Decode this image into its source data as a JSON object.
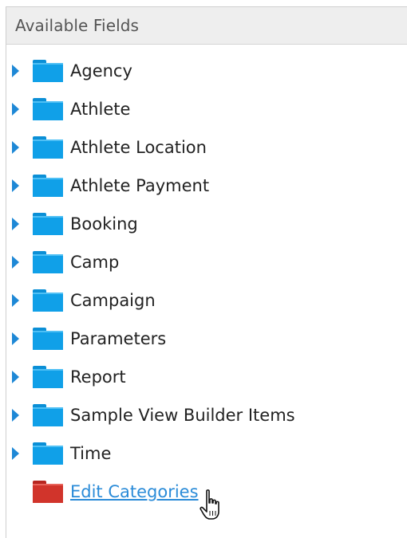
{
  "panel": {
    "title": "Available Fields"
  },
  "tree": {
    "items": [
      {
        "label": "Agency"
      },
      {
        "label": "Athlete"
      },
      {
        "label": "Athlete Location"
      },
      {
        "label": "Athlete Payment"
      },
      {
        "label": "Booking"
      },
      {
        "label": "Camp"
      },
      {
        "label": "Campaign"
      },
      {
        "label": "Parameters"
      },
      {
        "label": "Report"
      },
      {
        "label": "Sample View Builder Items"
      },
      {
        "label": "Time"
      }
    ],
    "edit_link": {
      "label": "Edit Categories"
    }
  },
  "colors": {
    "folder_blue": "#10a0e8",
    "folder_red": "#d1342b",
    "expander": "#1e88d6",
    "link": "#2a8bd8"
  },
  "icons": {
    "expander": "chevron-right-icon",
    "folder": "folder-icon",
    "cursor": "hand-pointer-cursor-icon"
  }
}
